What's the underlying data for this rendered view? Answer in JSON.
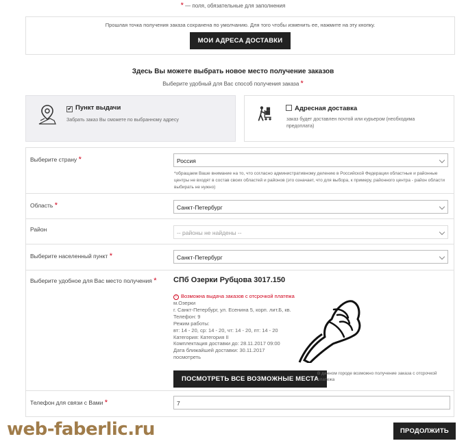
{
  "header": {
    "required_marker": "*",
    "required_note": "— поля, обязательные для заполнения"
  },
  "saved_point": {
    "text": "Прошлая точка получения заказа сохранена по умолчанию. Для того чтобы изменить ее, нажмите на эту кнопку.",
    "button_label": "МОИ АДРЕСА ДОСТАВКИ"
  },
  "choose": {
    "title": "Здесь Вы можете выбрать новое место получение заказов",
    "subtitle": "Выберите удобный для Вас способ получения заказа",
    "required_marker": "*"
  },
  "delivery_options": [
    {
      "title": "Пункт выдачи",
      "description": "Забрать заказ Вы сможете по выбранному адресу",
      "checked": true,
      "icon": "map-pin-icon"
    },
    {
      "title": "Адресная доставка",
      "description": "заказ будет доставлен почтой или курьером (необходима предоплата)",
      "checked": false,
      "icon": "courier-cart-icon"
    }
  ],
  "form": {
    "country": {
      "label": "Выберите страну",
      "value": "Россия",
      "note": "*обращаем Ваше внимание на то, что согласно административному делению в Российской Федерации областные и районные центры не входят в состав своих областей и районов (это означает, что для выбора, к примеру, районного центра - район области выбирать не нужно)"
    },
    "region": {
      "label": "Область",
      "value": "Санкт-Петербург"
    },
    "district": {
      "label": "Район",
      "value": "-- районы не найдены --"
    },
    "locality": {
      "label": "Выберите населенный пункт",
      "value": "Санкт-Петербург"
    },
    "pickup_point": {
      "label": "Выберите удобное для Вас место получения",
      "title": "СПб Озерки Рубцова 3017.150",
      "warning": "Возможна выдача заказов с отсрочкой платежа",
      "lines": [
        "м.Озерки",
        "г. Санкт-Петербург, ул. Есенина 5, корп. лит.Б, кв.",
        "Телефон: 9",
        "Режим работы:",
        "вт: 14 - 20, ср: 14 - 20, чт: 14 - 20, пт: 14 - 20",
        "Категория: Категория II",
        "Комплектация доставки до: 28.11.2017 09:00",
        "Дата ближайшей доставки: 30.11.2017",
        "посмотреть"
      ],
      "button_label": "ПОСМОТРЕТЬ ВСЕ ВОЗМОЖНЫЕ МЕСТА",
      "side_note": "В данном городе возможно получение заказа с отсрочкой платежа"
    },
    "phone": {
      "label": "Телефон для связи с Вами",
      "value": "7"
    }
  },
  "footer": {
    "watermark": "web-faberlic.ru",
    "next_button": "ПРОДОЛЖИТЬ"
  }
}
